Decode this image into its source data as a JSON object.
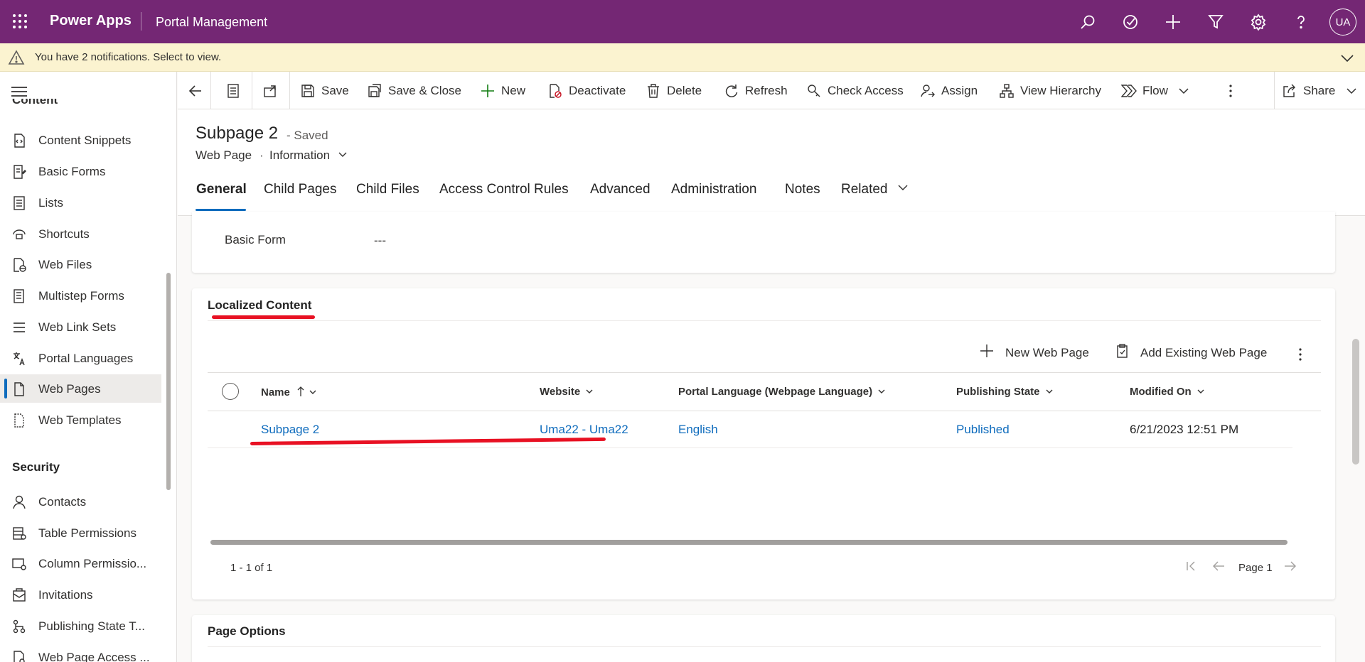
{
  "topbar": {
    "app_name": "Power Apps",
    "environment": "Portal Management",
    "avatar_initials": "UA",
    "icons": [
      "search-icon",
      "assistant-icon",
      "plus-icon",
      "filter-icon",
      "settings-icon",
      "help-icon"
    ],
    "background": "#742774"
  },
  "notification": {
    "message": "You have 2 notifications. Select to view."
  },
  "sidebar": {
    "partial_group": "Content",
    "items": [
      {
        "label": "Content Snippets",
        "icon": "snippet-icon"
      },
      {
        "label": "Basic Forms",
        "icon": "form-icon"
      },
      {
        "label": "Lists",
        "icon": "list-icon"
      },
      {
        "label": "Shortcuts",
        "icon": "shortcut-icon"
      },
      {
        "label": "Web Files",
        "icon": "web-file-icon"
      },
      {
        "label": "Multistep Forms",
        "icon": "multistep-form-icon"
      },
      {
        "label": "Web Link Sets",
        "icon": "link-set-icon"
      },
      {
        "label": "Portal Languages",
        "icon": "language-icon"
      },
      {
        "label": "Web Pages",
        "icon": "web-page-icon",
        "selected": true
      },
      {
        "label": "Web Templates",
        "icon": "template-icon"
      }
    ],
    "security_group": "Security",
    "security_items": [
      {
        "label": "Contacts",
        "icon": "contact-icon"
      },
      {
        "label": "Table Permissions",
        "icon": "table-permission-icon"
      },
      {
        "label": "Column Permissio...",
        "icon": "column-permission-icon"
      },
      {
        "label": "Invitations",
        "icon": "invitation-icon"
      },
      {
        "label": "Publishing State T...",
        "icon": "publishing-state-icon"
      },
      {
        "label": "Web Page Access ...",
        "icon": "page-access-icon"
      }
    ]
  },
  "commandbar": {
    "save": "Save",
    "save_close": "Save & Close",
    "new": "New",
    "deactivate": "Deactivate",
    "delete": "Delete",
    "refresh": "Refresh",
    "check_access": "Check Access",
    "assign": "Assign",
    "view_hierarchy": "View Hierarchy",
    "flow": "Flow",
    "share": "Share"
  },
  "header": {
    "title": "Subpage 2",
    "saved_status": "- Saved",
    "entity_type": "Web Page",
    "separator": "·",
    "form_name": "Information"
  },
  "tabs": [
    "General",
    "Child Pages",
    "Child Files",
    "Access Control Rules",
    "Advanced",
    "Administration",
    "Notes",
    "Related"
  ],
  "basic_form": {
    "label": "Basic Form",
    "value": "---"
  },
  "localized": {
    "title": "Localized Content",
    "new_button": "New Web Page",
    "add_existing_button": "Add Existing Web Page",
    "columns": {
      "name": "Name",
      "website": "Website",
      "language": "Portal Language (Webpage Language)",
      "state": "Publishing State",
      "modified": "Modified On"
    },
    "rows": [
      {
        "name": "Subpage 2",
        "website": "Uma22 - Uma22",
        "language": "English",
        "state": "Published",
        "modified": "6/21/2023 12:51 PM"
      }
    ],
    "record_count": "1 - 1 of 1",
    "page_label": "Page 1"
  },
  "page_options": {
    "title": "Page Options"
  },
  "colors": {
    "accent": "#0f6cbd",
    "annotation": "#e81123",
    "notification_bg": "#fbf3d0"
  }
}
